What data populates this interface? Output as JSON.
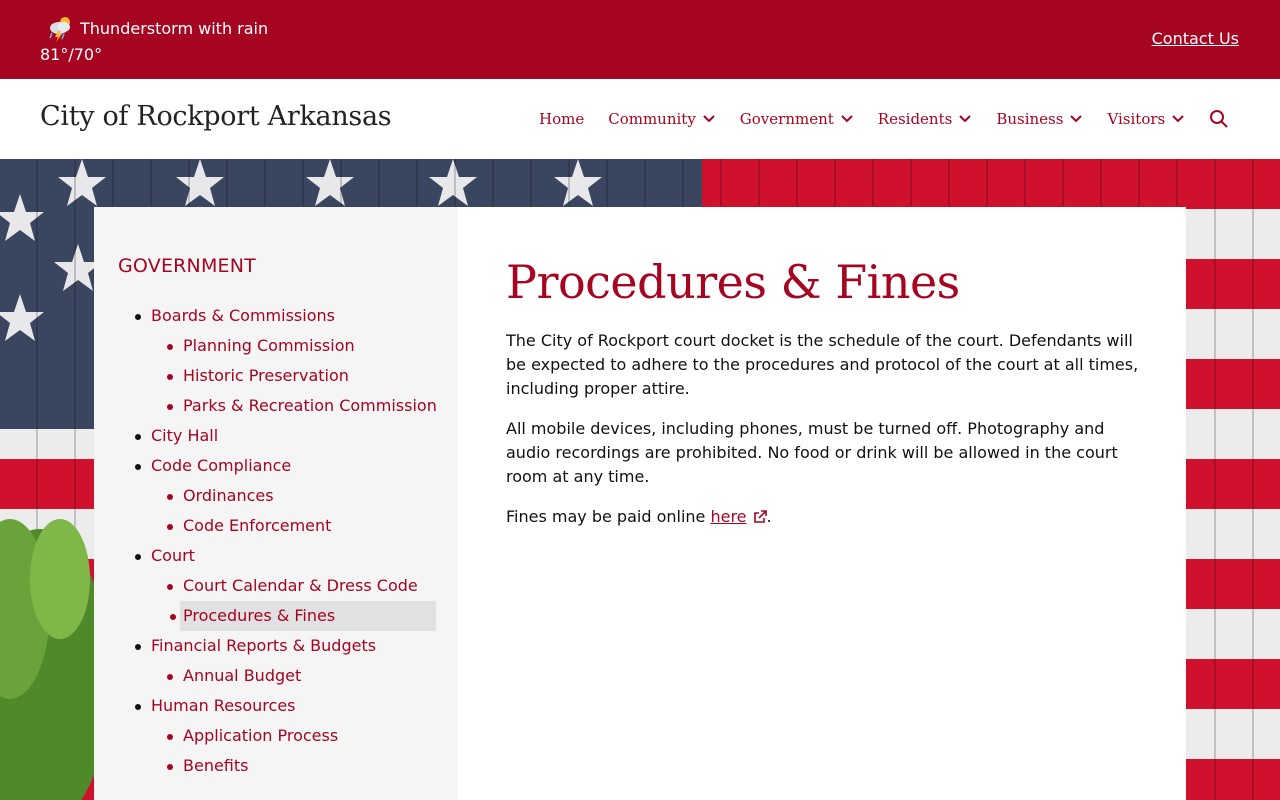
{
  "alert": {
    "weather_condition": "Thunderstorm with rain",
    "weather_temp": "81°/70°",
    "weather_icon": "thunderstorm-icon",
    "contact_label": "Contact Us"
  },
  "header": {
    "site_title": "City of Rockport Arkansas",
    "nav": {
      "home": "Home",
      "community": "Community",
      "government": "Government",
      "residents": "Residents",
      "business": "Business",
      "visitors": "Visitors"
    },
    "search_icon": "search-icon"
  },
  "sidebar": {
    "heading": "GOVERNMENT",
    "items": [
      {
        "label": "Boards & Commissions",
        "children": [
          "Planning Commission",
          "Historic Preservation",
          "Parks & Recreation Commission"
        ]
      },
      {
        "label": "City Hall",
        "children": []
      },
      {
        "label": "Code Compliance",
        "children": [
          "Ordinances",
          "Code Enforcement"
        ]
      },
      {
        "label": "Court",
        "children": [
          "Court Calendar & Dress Code",
          "Procedures & Fines"
        ]
      },
      {
        "label": "Financial Reports & Budgets",
        "children": [
          "Annual Budget"
        ]
      },
      {
        "label": "Human Resources",
        "children": [
          "Application Process",
          "Benefits"
        ]
      }
    ],
    "active_item": "Procedures & Fines"
  },
  "main": {
    "title": "Procedures & Fines",
    "paragraph1": "The City of Rockport court docket is the schedule of the court. Defendants will be expected to adhere to the procedures and protocol of the court at all times, including proper attire.",
    "paragraph2": "All mobile devices, including phones, must be turned off. Photography and audio recordings are prohibited. No food or drink will be allowed in the court room at any time.",
    "paragraph3_prefix": "Fines may be paid online",
    "paragraph3_link": "here",
    "paragraph3_suffix": ".",
    "external_link_icon": "external-link-icon"
  },
  "colors": {
    "brand": "#a50521",
    "sidebar_bg": "#f5f5f5",
    "active_bg": "#e1e1e1"
  }
}
